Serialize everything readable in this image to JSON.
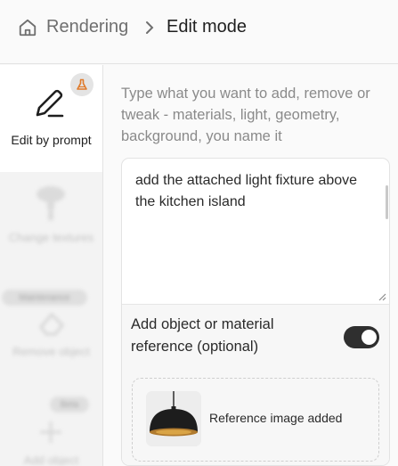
{
  "breadcrumb": {
    "root": "Rendering",
    "current": "Edit mode"
  },
  "sidebar": {
    "items": [
      {
        "label": "Edit by prompt",
        "icon": "pencil-icon",
        "active": true,
        "badge_icon": "flask-icon"
      },
      {
        "label": "Change textures",
        "icon": "paint-roller-icon",
        "active": false
      },
      {
        "label": "Remove object",
        "icon": "eraser-icon",
        "active": false,
        "badge": "Maintenance"
      },
      {
        "label": "Add object",
        "icon": "add-object-icon",
        "active": false,
        "badge": "Beta"
      }
    ]
  },
  "editor": {
    "instructions": "Type what you want to add, remove or tweak - materials, light, geometry, background, you name it",
    "prompt_value": "add the attached light fixture above the kitchen island",
    "reference_toggle_label": "Add object or material reference (optional)",
    "reference_toggle_on": true,
    "reference_status": "Reference image added"
  },
  "colors": {
    "accent_dark": "#2f2f2f",
    "badge_orange": "#e07a2a"
  }
}
